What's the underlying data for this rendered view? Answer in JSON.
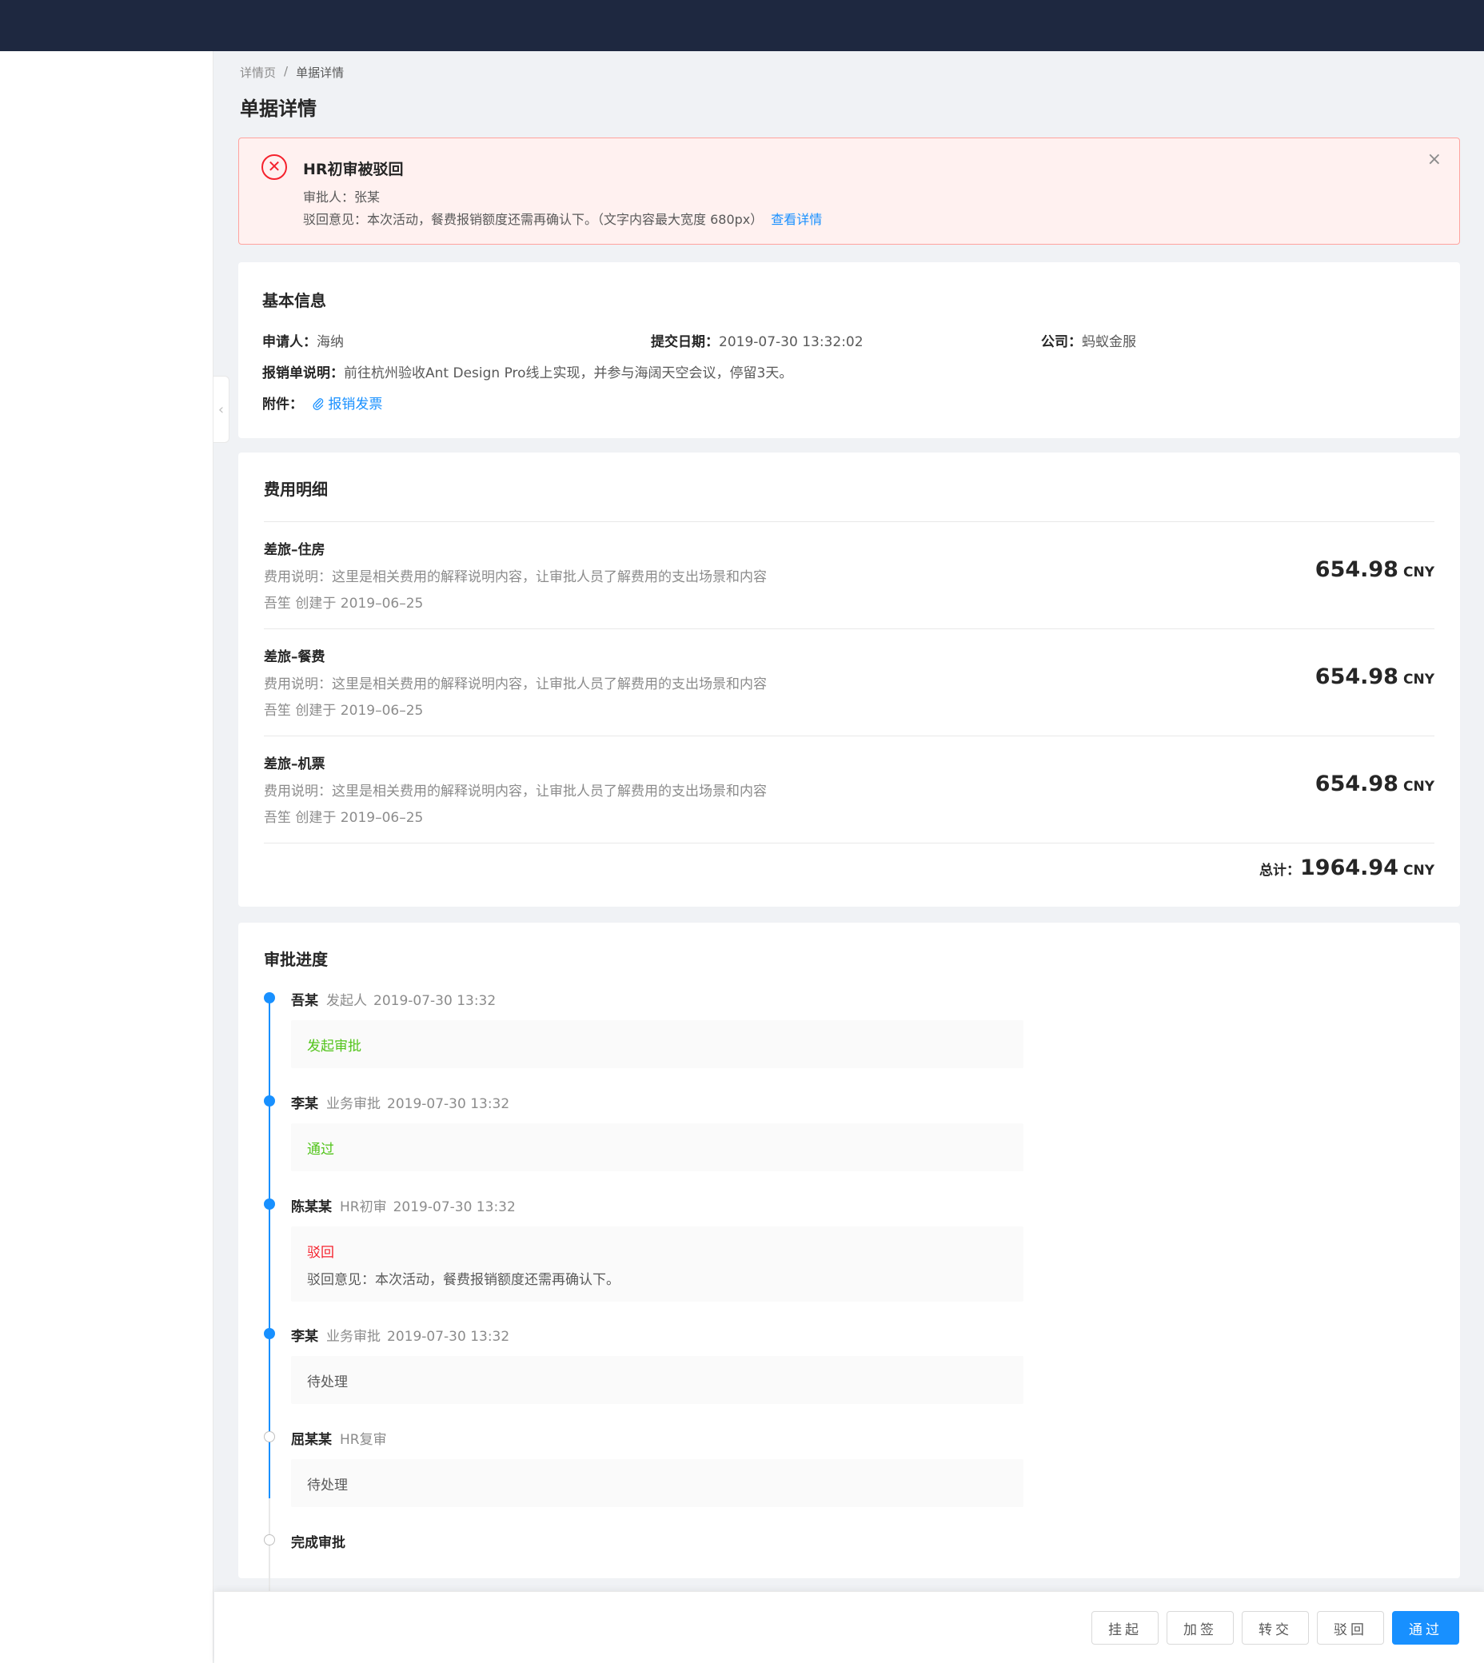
{
  "breadcrumb": [
    "详情页",
    "单据详情"
  ],
  "breadcrumb_sep": "/",
  "page_title": "单据详情",
  "alert": {
    "title": "HR初审被驳回",
    "approver": "审批人：张某",
    "reason": "驳回意见：本次活动，餐费报销额度还需再确认下。（文字内容最大宽度 680px）",
    "link": "查看详情",
    "close": "×",
    "icon": "✕"
  },
  "basic": {
    "title": "基本信息",
    "applicant_label": "申请人：",
    "applicant": "海纳",
    "date_label": "提交日期：",
    "date": "2019-07-30 13:32:02",
    "company_label": "公司：",
    "company": "蚂蚁金服",
    "desc_label": "报销单说明：",
    "desc": "前往杭州验收Ant Design Pro线上实现，并参与海阔天空会议，停留3天。",
    "attach_label": "附件：",
    "attach": "报销发票"
  },
  "fee": {
    "title": "费用明细",
    "items": [
      {
        "name": "差旅–住房",
        "desc": "费用说明：这里是相关费用的解释说明内容，让审批人员了解费用的支出场景和内容",
        "meta": "吾笙 创建于 2019–06–25",
        "amount": "654.98",
        "currency": "CNY"
      },
      {
        "name": "差旅–餐费",
        "desc": "费用说明：这里是相关费用的解释说明内容，让审批人员了解费用的支出场景和内容",
        "meta": "吾笙 创建于 2019–06–25",
        "amount": "654.98",
        "currency": "CNY"
      },
      {
        "name": "差旅–机票",
        "desc": "费用说明：这里是相关费用的解释说明内容，让审批人员了解费用的支出场景和内容",
        "meta": "吾笙 创建于 2019–06–25",
        "amount": "654.98",
        "currency": "CNY"
      }
    ],
    "total_label": "总计：",
    "total": "1964.94",
    "total_currency": "CNY"
  },
  "approval": {
    "title": "审批进度",
    "steps": [
      {
        "name": "吾某",
        "role": "发起人",
        "time": "2019-07-30 13:32",
        "status": "发起审批",
        "status_color": "#52c41a",
        "done": true
      },
      {
        "name": "李某",
        "role": "业务审批",
        "time": "2019-07-30 13:32",
        "status": "通过",
        "status_color": "#52c41a",
        "done": true
      },
      {
        "name": "陈某某",
        "role": "HR初审",
        "time": "2019-07-30 13:32",
        "status": "驳回",
        "status_color": "#f5222d",
        "comment": "驳回意见：本次活动，餐费报销额度还需再确认下。",
        "done": true
      },
      {
        "name": "李某",
        "role": "业务审批",
        "time": "2019-07-30 13:32",
        "status": "待处理",
        "status_color": "#595959",
        "done": true
      },
      {
        "name": "屈某某",
        "role": "HR复审",
        "time": "",
        "status": "待处理",
        "status_color": "#595959",
        "done": false
      },
      {
        "name": "完成审批",
        "role": "",
        "time": "",
        "done": false
      }
    ]
  },
  "footer": {
    "buttons": [
      "挂起",
      "加签",
      "转交",
      "驳回",
      "通过"
    ]
  },
  "colors": {
    "primary": "#1890ff",
    "error": "#f5222d",
    "success": "#52c41a",
    "header": "#1e2840"
  },
  "icons": {
    "collapse": "chevron-left-icon",
    "attach": "paperclip-icon",
    "close": "close-icon",
    "error": "close-circle-icon"
  }
}
